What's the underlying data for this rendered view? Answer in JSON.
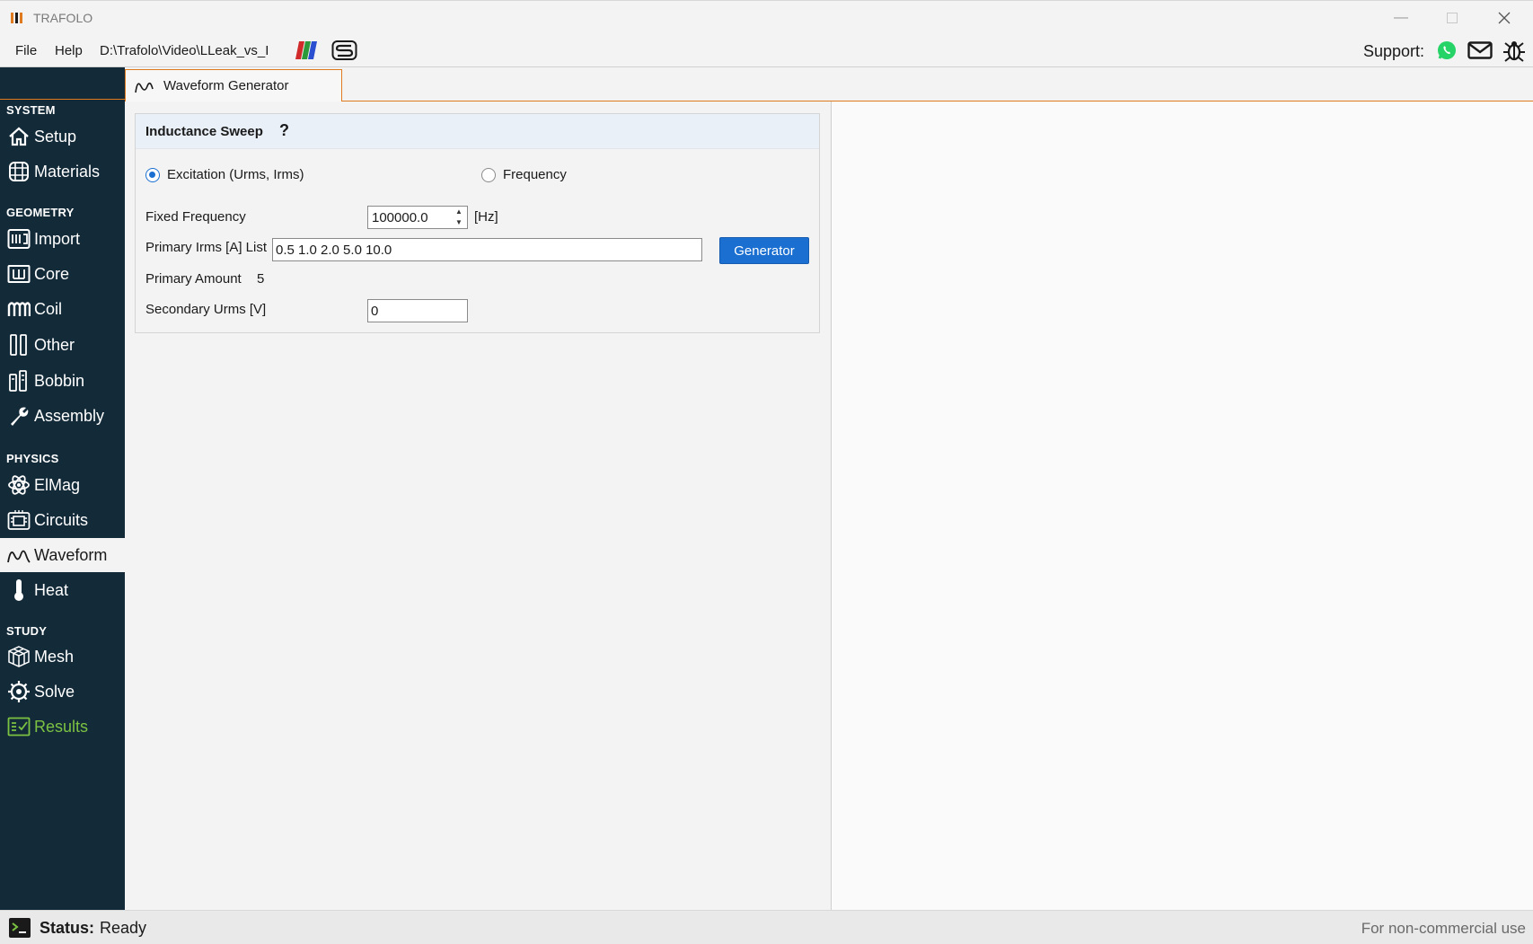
{
  "window": {
    "title": "TRAFOLO",
    "controls": [
      "minimize-icon",
      "maximize-icon",
      "close-icon"
    ]
  },
  "menubar": {
    "file_label": "File",
    "help_label": "Help",
    "project_path": "D:\\Trafolo\\Video\\LLeak_vs_I",
    "support_label": "Support:",
    "icons": [
      "multicolor-stripes-icon",
      "s-logo-icon",
      "whatsapp-icon",
      "mail-icon",
      "bug-icon"
    ]
  },
  "sidebar": {
    "sections": {
      "system": "SYSTEM",
      "geometry": "GEOMETRY",
      "physics": "PHYSICS",
      "study": "STUDY"
    },
    "items": {
      "setup": "Setup",
      "materials": "Materials",
      "import": "Import",
      "core": "Core",
      "coil": "Coil",
      "other": "Other",
      "bobbin": "Bobbin",
      "assembly": "Assembly",
      "elmag": "ElMag",
      "circuits": "Circuits",
      "waveform": "Waveform",
      "heat": "Heat",
      "mesh": "Mesh",
      "solve": "Solve",
      "results": "Results"
    },
    "active": "waveform"
  },
  "tabs": {
    "active_tab_label": "Waveform Generator"
  },
  "inductance_sweep": {
    "title": "Inductance Sweep",
    "help_mark": "?",
    "radio_excitation": "Excitation (Urms, Irms)",
    "radio_frequency": "Frequency",
    "selected": "excitation",
    "fixed_frequency_label": "Fixed Frequency",
    "fixed_frequency_value": "100000.0",
    "fixed_frequency_unit": "[Hz]",
    "primary_irms_label": "Primary Irms [A] List",
    "primary_irms_value": "0.5 1.0 2.0 5.0 10.0",
    "generator_label": "Generator",
    "primary_amount_label": "Primary Amount",
    "primary_amount_value": "5",
    "secondary_urms_label": "Secondary Urms [V]",
    "secondary_urms_value": "0"
  },
  "statusbar": {
    "label": "Status:",
    "value": "Ready",
    "license_note": "For non-commercial use"
  },
  "colors": {
    "sidebar_bg": "#132a39",
    "accent_orange": "#e07a1f",
    "primary_blue": "#1a6fd1",
    "results_green": "#7cc242"
  }
}
